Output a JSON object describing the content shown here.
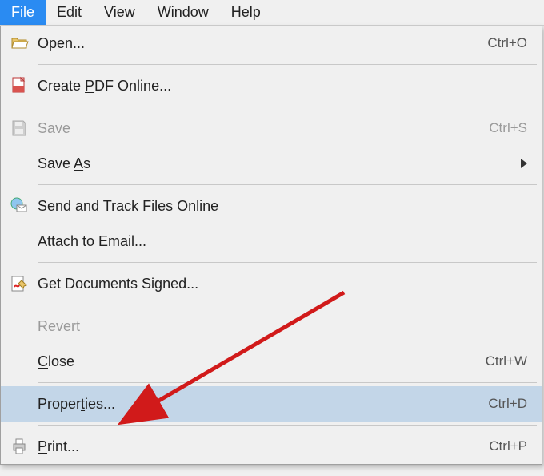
{
  "menubar": {
    "items": [
      {
        "label": "File",
        "active": true
      },
      {
        "label": "Edit"
      },
      {
        "label": "View"
      },
      {
        "label": "Window"
      },
      {
        "label": "Help"
      }
    ]
  },
  "menu": {
    "open": {
      "label": "Open...",
      "shortcut": "Ctrl+O",
      "accel_index": 0
    },
    "create_pdf": {
      "label": "Create PDF Online...",
      "accel_index": 7
    },
    "save": {
      "label": "Save",
      "shortcut": "Ctrl+S",
      "accel_index": 0,
      "disabled": true
    },
    "save_as": {
      "label": "Save As",
      "accel_index": 5,
      "has_submenu": true
    },
    "send_track": {
      "label": "Send and Track Files Online"
    },
    "attach_email": {
      "label": "Attach to Email..."
    },
    "get_signed": {
      "label": "Get Documents Signed..."
    },
    "revert": {
      "label": "Revert",
      "disabled": true
    },
    "close": {
      "label": "Close",
      "shortcut": "Ctrl+W",
      "accel_index": 0
    },
    "properties": {
      "label": "Properties...",
      "shortcut": "Ctrl+D",
      "accel_index": 6,
      "highlighted": true
    },
    "print": {
      "label": "Print...",
      "shortcut": "Ctrl+P",
      "accel_index": 0
    }
  },
  "annotation": {
    "arrow_color": "#d11a1a"
  }
}
